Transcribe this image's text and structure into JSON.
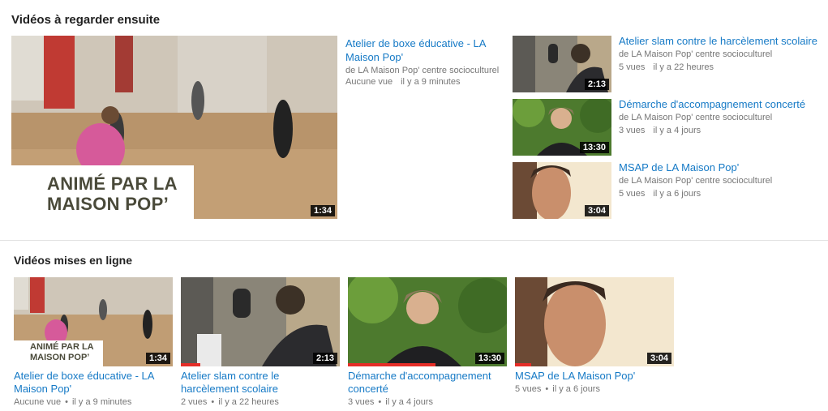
{
  "sections": {
    "watch_next": "Vidéos à regarder ensuite",
    "uploads": "Vidéos mises en ligne"
  },
  "featured": {
    "title": "Atelier de boxe éducative - LA Maison Pop'",
    "channel": "de LA Maison Pop' centre socioculturel",
    "views": "Aucune vue",
    "age": "il y a 9 minutes",
    "duration": "1:34",
    "overlay_line1": "ANIMÉ PAR LA",
    "overlay_line2": "MAISON POP’"
  },
  "side_videos": [
    {
      "title": "Atelier slam contre le harcèlement scolaire",
      "channel": "de LA Maison Pop' centre socioculturel",
      "views": "5 vues",
      "age": "il y a 22 heures",
      "duration": "2:13"
    },
    {
      "title": "Démarche d'accompagnement concerté",
      "channel": "de LA Maison Pop' centre socioculturel",
      "views": "3 vues",
      "age": "il y a 4 jours",
      "duration": "13:30"
    },
    {
      "title": "MSAP de LA Maison Pop'",
      "channel": "de LA Maison Pop' centre socioculturel",
      "views": "5 vues",
      "age": "il y a 6 jours",
      "duration": "3:04"
    }
  ],
  "uploads": [
    {
      "title": "Atelier de boxe éducative - LA Maison Pop'",
      "views": "Aucune vue",
      "age": "il y a 9 minutes",
      "duration": "1:34",
      "overlay_line1": "ANIMÉ PAR LA",
      "overlay_line2": "MAISON POP’"
    },
    {
      "title": "Atelier slam contre le harcèlement scolaire",
      "views": "2 vues",
      "age": "il y a 22 heures",
      "duration": "2:13",
      "progress": 0.12
    },
    {
      "title": "Démarche d'accompagnement concerté",
      "views": "3 vues",
      "age": "il y a 4 jours",
      "duration": "13:30",
      "progress": 0.55
    },
    {
      "title": "MSAP de LA Maison Pop'",
      "views": "5 vues",
      "age": "il y a 6 jours",
      "duration": "3:04",
      "progress": 0.1
    }
  ],
  "colors": {
    "link": "#167ac6",
    "meta": "#767676",
    "progress": "#e52d27"
  }
}
